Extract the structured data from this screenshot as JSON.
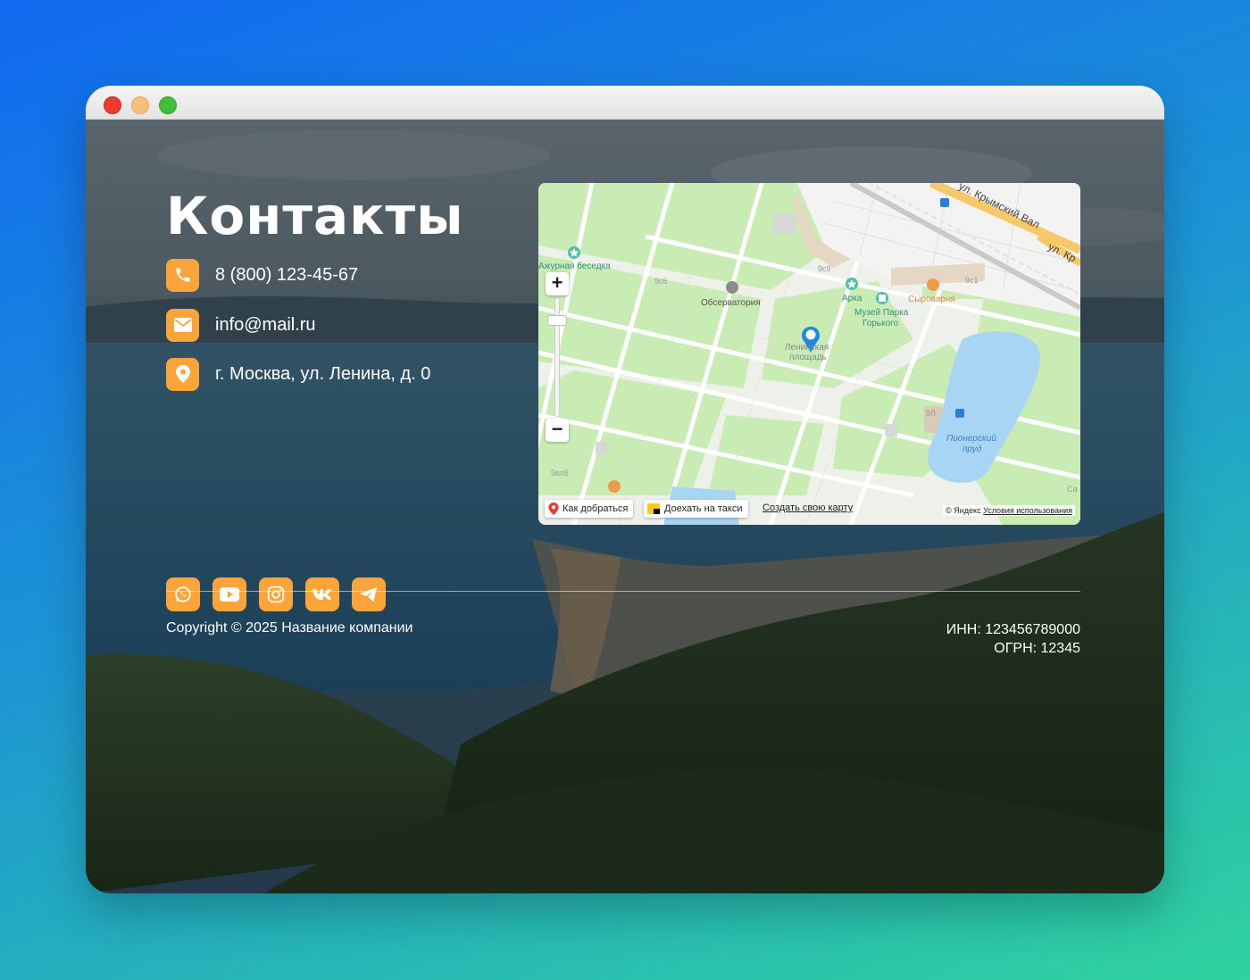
{
  "page": {
    "title": "Контакты",
    "contacts": {
      "phone": "8 (800) 123-45-67",
      "email": "info@mail.ru",
      "address": "г. Москва, ул. Ленина, д. 0"
    },
    "socials": [
      "whatsapp-icon",
      "youtube-icon",
      "instagram-icon",
      "vk-icon",
      "telegram-icon"
    ],
    "footer": {
      "copyright": "Copyright © 2025 Название компании",
      "inn": "ИНН: 123456789000",
      "ogrn": "ОГРН: 12345"
    }
  },
  "map": {
    "zoom_in": "+",
    "zoom_out": "−",
    "labels": {
      "street1": "ул. Крымский Вал",
      "street2": "ул. Кр",
      "gazebo": "Ажурная беседка",
      "observatory": "Обсерватория",
      "arch": "Арка",
      "museum_line1": "Музей Парка",
      "museum_line2": "Горького",
      "cheese": "Сыроварня",
      "square_line1": "Ленинская",
      "square_line2": "площадь",
      "pond_line1": "Пионерский",
      "pond_line2": "пруд",
      "b1": "9с9",
      "b2": "9с6",
      "b3": "9с1",
      "b4": "9Л",
      "b5": "9вл8",
      "edge": "Са"
    },
    "route_button": "Как добраться",
    "taxi_button": "Доехать на такси",
    "create_link": "Создать свою карту",
    "attribution_prefix": "© Яндекс",
    "attribution_link": "Условия использования"
  },
  "colors": {
    "accent": "#fba43a",
    "map_park": "#c9ecb4",
    "map_water": "#a9d5f5",
    "marker": "#1e88e5"
  }
}
